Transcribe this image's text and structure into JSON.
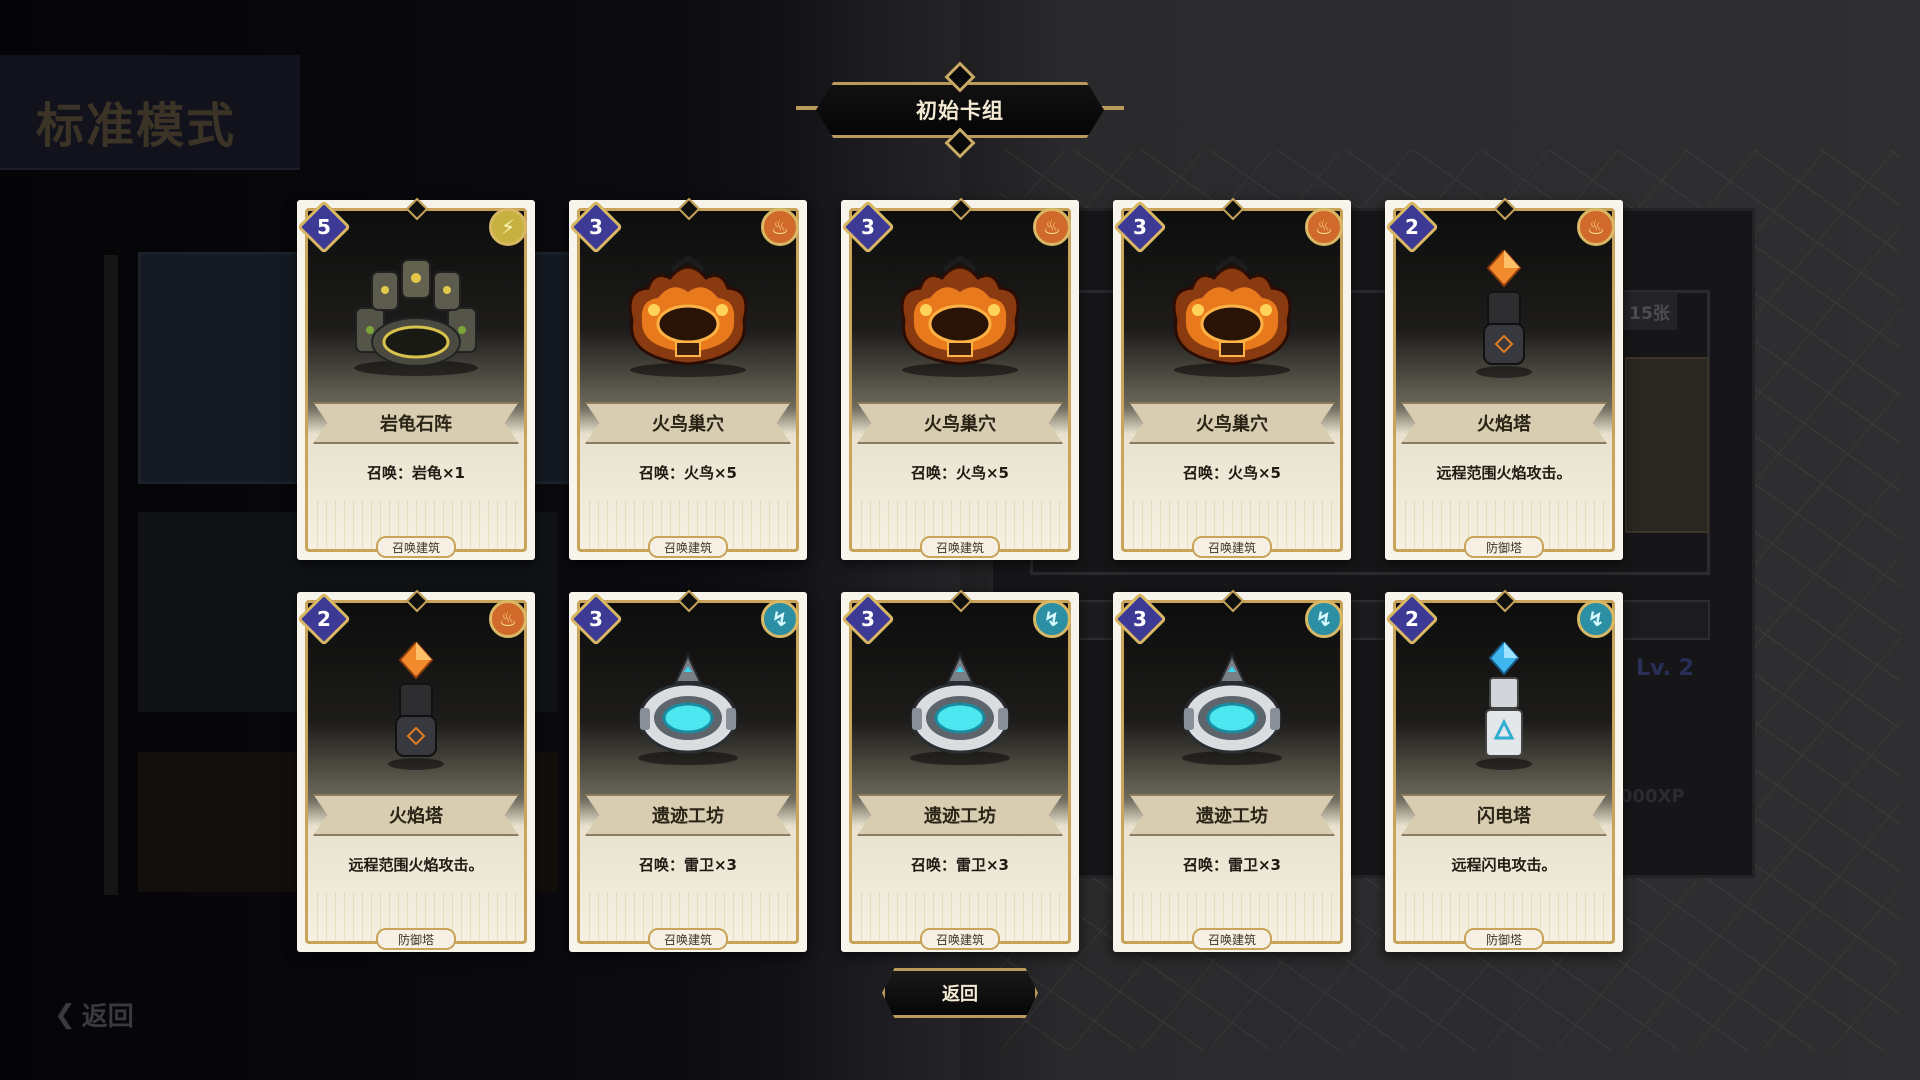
{
  "background": {
    "mode_title": "标准模式",
    "deck_count": "15张",
    "level": "Lv. 2",
    "xp": "000XP",
    "back_label": "返回"
  },
  "dialog": {
    "title": "初始卡组",
    "back_button": "返回"
  },
  "colors": {
    "gold": "#c9a45a",
    "cost_gem": "#3d3a96",
    "fire": "#d0692a",
    "thunder": "#2d8fa3",
    "earth": "#c7b241"
  },
  "cards": [
    {
      "cost": "5",
      "element": "earth",
      "element_icon": "bolt-icon",
      "name": "岩龟石阵",
      "desc": "召唤：岩龟×1",
      "type": "召唤建筑",
      "art": "stone-ring"
    },
    {
      "cost": "3",
      "element": "fire",
      "element_icon": "flame-icon",
      "name": "火鸟巢穴",
      "desc": "召唤：火鸟×5",
      "type": "召唤建筑",
      "art": "fire-nest"
    },
    {
      "cost": "3",
      "element": "fire",
      "element_icon": "flame-icon",
      "name": "火鸟巢穴",
      "desc": "召唤：火鸟×5",
      "type": "召唤建筑",
      "art": "fire-nest"
    },
    {
      "cost": "3",
      "element": "fire",
      "element_icon": "flame-icon",
      "name": "火鸟巢穴",
      "desc": "召唤：火鸟×5",
      "type": "召唤建筑",
      "art": "fire-nest"
    },
    {
      "cost": "2",
      "element": "fire",
      "element_icon": "flame-icon",
      "name": "火焰塔",
      "desc": "远程范围火焰攻击。",
      "type": "防御塔",
      "art": "fire-tower"
    },
    {
      "cost": "2",
      "element": "fire",
      "element_icon": "flame-icon",
      "name": "火焰塔",
      "desc": "远程范围火焰攻击。",
      "type": "防御塔",
      "art": "fire-tower"
    },
    {
      "cost": "3",
      "element": "thunder",
      "element_icon": "lightning-icon",
      "name": "遗迹工坊",
      "desc": "召唤：雷卫×3",
      "type": "召唤建筑",
      "art": "relic-workshop"
    },
    {
      "cost": "3",
      "element": "thunder",
      "element_icon": "lightning-icon",
      "name": "遗迹工坊",
      "desc": "召唤：雷卫×3",
      "type": "召唤建筑",
      "art": "relic-workshop"
    },
    {
      "cost": "3",
      "element": "thunder",
      "element_icon": "lightning-icon",
      "name": "遗迹工坊",
      "desc": "召唤：雷卫×3",
      "type": "召唤建筑",
      "art": "relic-workshop"
    },
    {
      "cost": "2",
      "element": "thunder",
      "element_icon": "lightning-icon",
      "name": "闪电塔",
      "desc": "远程闪电攻击。",
      "type": "防御塔",
      "art": "thunder-tower"
    }
  ]
}
